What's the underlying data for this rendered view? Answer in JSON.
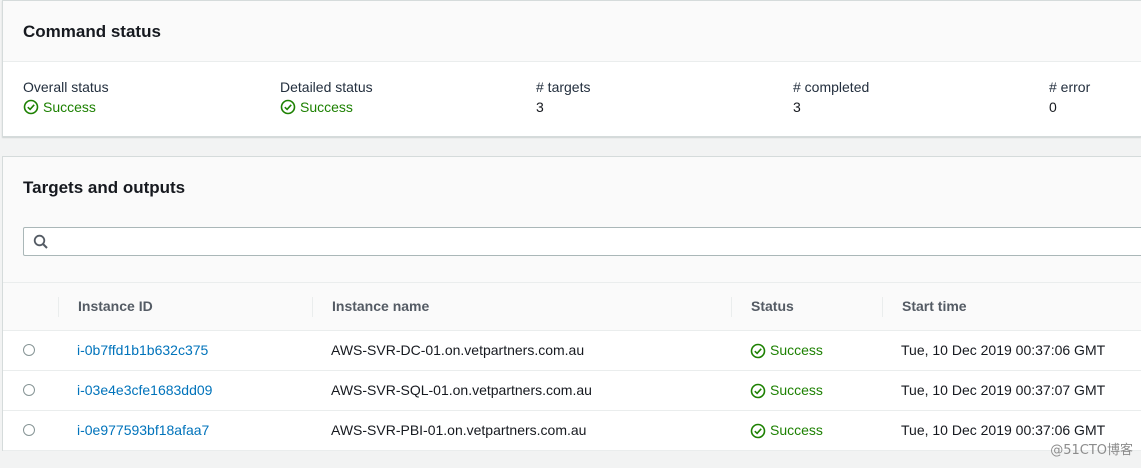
{
  "command_status": {
    "title": "Command status",
    "items": [
      {
        "label": "Overall status",
        "value": "Success",
        "type": "status"
      },
      {
        "label": "Detailed status",
        "value": "Success",
        "type": "status"
      },
      {
        "label": "# targets",
        "value": "3",
        "type": "number"
      },
      {
        "label": "# completed",
        "value": "3",
        "type": "number"
      },
      {
        "label": "# error",
        "value": "0",
        "type": "number"
      }
    ]
  },
  "targets": {
    "title": "Targets and outputs",
    "search": {
      "value": "",
      "placeholder": ""
    },
    "columns": [
      "Instance ID",
      "Instance name",
      "Status",
      "Start time"
    ],
    "rows": [
      {
        "id": "i-0b7ffd1b1b632c375",
        "name": "AWS-SVR-DC-01.on.vetpartners.com.au",
        "status": "Success",
        "start": "Tue, 10 Dec 2019 00:37:06 GMT"
      },
      {
        "id": "i-03e4e3cfe1683dd09",
        "name": "AWS-SVR-SQL-01.on.vetpartners.com.au",
        "status": "Success",
        "start": "Tue, 10 Dec 2019 00:37:07 GMT"
      },
      {
        "id": "i-0e977593bf18afaa7",
        "name": "AWS-SVR-PBI-01.on.vetpartners.com.au",
        "status": "Success",
        "start": "Tue, 10 Dec 2019 00:37:06 GMT"
      }
    ]
  },
  "watermark": "@51CTO博客",
  "colors": {
    "success": "#1d8102",
    "link": "#0073bb"
  },
  "icons": {
    "status": "check-circle-icon",
    "search": "search-icon",
    "select": "radio-button"
  }
}
